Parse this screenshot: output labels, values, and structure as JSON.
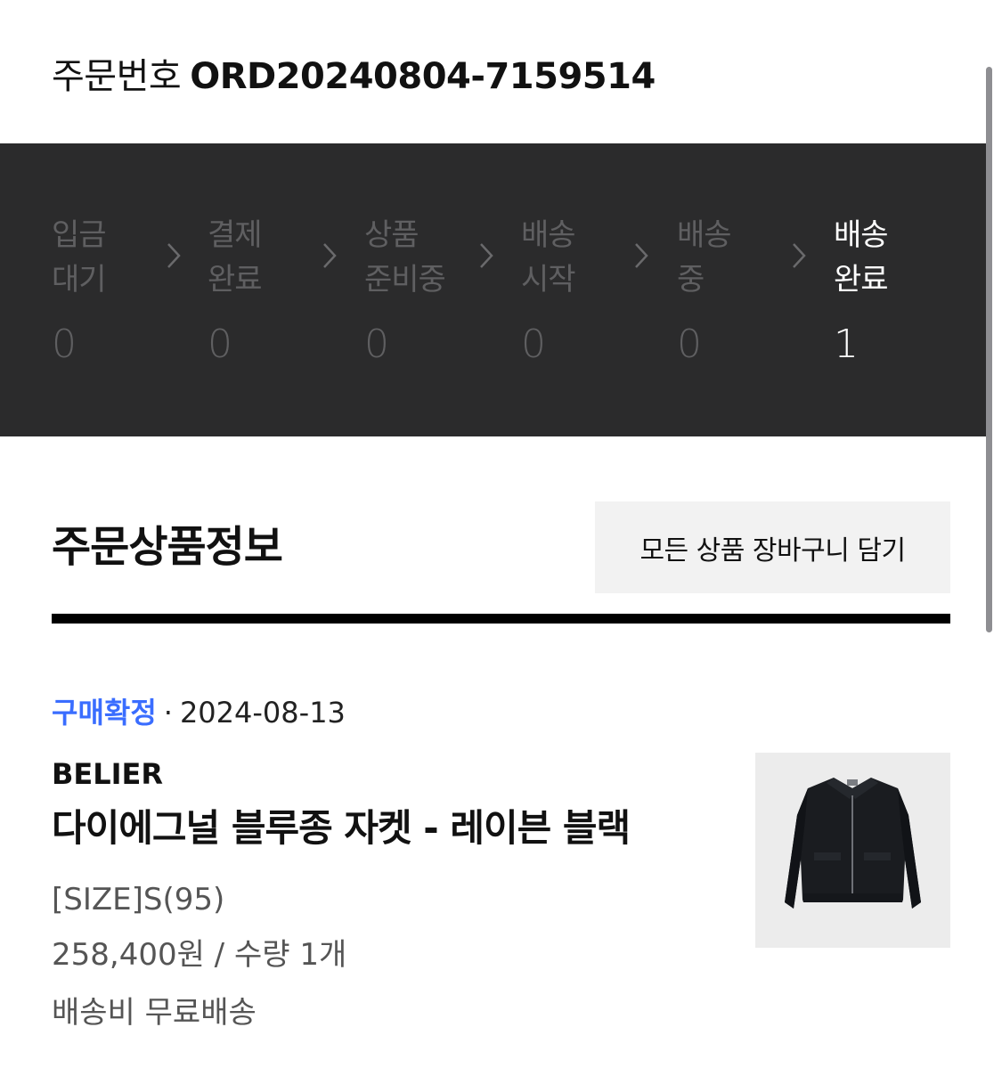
{
  "order": {
    "label": "주문번호",
    "number": "ORD20240804-7159514"
  },
  "progress": {
    "steps": [
      {
        "label": "입금\n대기",
        "count": "0"
      },
      {
        "label": "결제\n완료",
        "count": "0"
      },
      {
        "label": "상품\n준비중",
        "count": "0"
      },
      {
        "label": "배송\n시작",
        "count": "0"
      },
      {
        "label": "배송\n중",
        "count": "0"
      },
      {
        "label": "배송\n완료",
        "count": "1"
      }
    ],
    "active_step": 5
  },
  "section": {
    "title": "주문상품정보",
    "cart_button_label": "모든 상품 장바구니 담기"
  },
  "item": {
    "status": "구매확정",
    "separator": "·",
    "date": "2024-08-13",
    "brand": "BELIER",
    "name": "다이에그널 블루종 자켓 - 레이븐 블랙",
    "option": "[SIZE]S(95)",
    "price_quantity": "258,400원 / 수량 1개",
    "shipping": "배송비 무료배송",
    "thumbnail_icon": "jacket-image"
  },
  "colors": {
    "status_band": "#2b2b2c",
    "active_text": "#ffffff",
    "inactive_text": "#5f5f61",
    "confirm_blue": "#3a6dff",
    "button_bg": "#f2f2f2"
  }
}
